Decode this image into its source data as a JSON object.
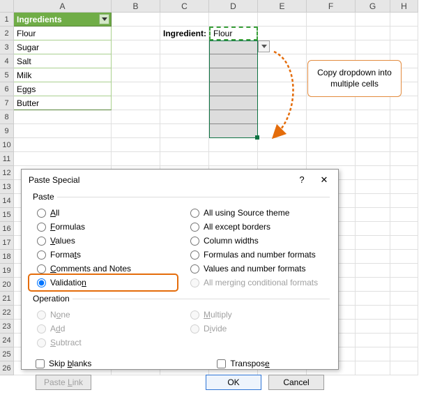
{
  "columns": [
    "A",
    "B",
    "C",
    "D",
    "E",
    "F",
    "G",
    "H"
  ],
  "rowCount": 26,
  "table": {
    "header": "Ingredients",
    "items": [
      "Flour",
      "Sugar",
      "Salt",
      "Milk",
      "Eggs",
      "Butter"
    ]
  },
  "labelCell": "Ingredient:",
  "copiedValue": "Flour",
  "callout": "Copy dropdown into multiple cells",
  "dialog": {
    "title": "Paste Special",
    "help": "?",
    "close": "✕",
    "groupPaste": "Paste",
    "pasteOptsL": [
      {
        "label": "All",
        "u": "A"
      },
      {
        "label": "Formulas",
        "u": "F"
      },
      {
        "label": "Values",
        "u": "V"
      },
      {
        "label": "Formats",
        "u": "T",
        "display": "Formats"
      },
      {
        "label": "Comments and Notes",
        "u": "C"
      },
      {
        "label": "Validation",
        "u": "N",
        "checked": true,
        "highlight": true
      }
    ],
    "pasteOptsR": [
      {
        "label": "All using Source theme"
      },
      {
        "label": "All except borders"
      },
      {
        "label": "Column widths"
      },
      {
        "label": "Formulas and number formats"
      },
      {
        "label": "Values and number formats"
      },
      {
        "label": "All merging conditional formats",
        "disabled": true
      }
    ],
    "groupOperation": "Operation",
    "opOptsL": [
      {
        "label": "None",
        "u": "O",
        "disabled": true
      },
      {
        "label": "Add",
        "u": "D",
        "disabled": true
      },
      {
        "label": "Subtract",
        "u": "S",
        "disabled": true
      }
    ],
    "opOptsR": [
      {
        "label": "Multiply",
        "u": "M",
        "disabled": true
      },
      {
        "label": "Divide",
        "u": "I",
        "disabled": true
      }
    ],
    "skipBlanks": "Skip blanks",
    "transpose": "Transpose",
    "pasteLink": "Paste Link",
    "ok": "OK",
    "cancel": "Cancel"
  }
}
